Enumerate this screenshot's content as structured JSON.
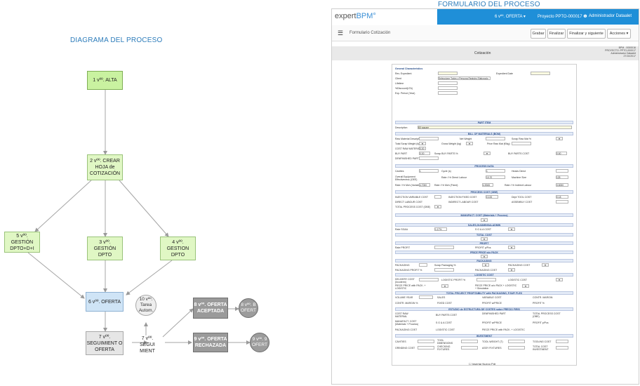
{
  "diagram": {
    "title": "DIAGRAMA DEL PROCESO",
    "nodes": {
      "n1": "1 vºº. ALTA",
      "n2": "2 vºº. CREAR HOJA de COTIZACIÓN",
      "n3": "3 vºº. GESTIÓN DPTO",
      "n4": "4 vºº. GESTION DPTO",
      "n5": "5 vºº. GESTIÓN DPTO+D+I",
      "n6": "6 vºº. OFERTA",
      "n7": "7 vºº. SEGUIMIENT O OFERTA",
      "n8": "8 vºº. OFERTA ACEPTADA",
      "n9": "9 vºº. OFERTA RECHAZADA",
      "n10": "10 vºº. Tarea Autom.",
      "seg": "7 vºº. SEGUI MIENT",
      "n8b": "8 vºº. B OFERT",
      "n9b": "9 vºº. 9 OFERT"
    }
  },
  "form": {
    "title": "FORMULARIO DEL PROCESO",
    "logo_a": "expert",
    "logo_b": "BPM",
    "logo_c": "°",
    "nav": {
      "oferta": "6 vºº. OFERTA ▾",
      "proyecto": "Proyecto PPTO-000017 ❶",
      "admin": "Administrador Dataalet"
    },
    "subtitle": "Formulario Cotización",
    "buttons": {
      "grabar": "Grabar",
      "finalizar": "Finalizar",
      "finalizar_siguiente": "Finalizar y siguiente",
      "acciones": "Acciones ▾"
    },
    "band_title": "Cotización",
    "meta": [
      "BPM - 0000016",
      "PROYECTO: PPTO-000017",
      "Administrador Dataalet",
      "27/10/2017"
    ],
    "general": "General Characteristics",
    "gen_labels": [
      "Rev. Expedient",
      "Client",
      "Lifetime",
      "%Discount(LTA)",
      "Exp. Period (Year)"
    ],
    "gen_client": "Seleccione Todos y Persona Registro Elaborado",
    "exp_date": "Expedient Date",
    "sections": {
      "part": "PART ITEM",
      "bom": "BILL OF MATERIALS (BOM)",
      "process": "PROCESS DATA",
      "proc_cost": "PROCESS COST (OBE)",
      "manufact": "MANUFACT. COST (Materials + Process)",
      "sga": "SALES,G/ADMINSALADMIN",
      "total": "TOTAL COST",
      "profit": "PROFIT",
      "price": "PRICE PRICE w/o PACK",
      "packaging": "PACKAGING",
      "logistic": "LOGISTIC COST",
      "tppp": "TOTAL PROJECT PROFITABILITY with PACKAGING, F.SUP. FLEX",
      "estudio": "ESTUDIO de ESTRUCTURA DE COSTES sobre PRECIO FIRIS",
      "invest": "INVESTMENT"
    },
    "description_label": "Description",
    "description_value": "B3 square",
    "bom_labels": [
      "Raw Material Description",
      "Total Scrap Weight (kg)",
      "COST RAW MATERIAL",
      "BUY PART",
      "DENFINISHED PART"
    ],
    "bom_mid": [
      "Net Weight",
      "Gross Weight (kg)",
      "Scrap BUY PARTS %"
    ],
    "bom_right": [
      "Scrap Raw Mat %",
      "Price Raw Mat (€/kg)",
      "BUY PARTS COST"
    ],
    "bom_values": [
      "0.00",
      "0.00",
      "0.00",
      "0.60"
    ],
    "proc_labels": [
      "Cavities",
      "Overall Equipment Effectiveness (OEE)",
      "Rate / Hr Mch (Variable)"
    ],
    "proc_mid": [
      "Cycle (s)",
      "Rate / Hr Direct Labour",
      "Rate / Hr Mch (Fixed)"
    ],
    "proc_right": [
      "Heads Direct",
      "Machine Size",
      "Rate / Hr Indirect Labour"
    ],
    "proc_values": [
      "1",
      "1",
      "10.70",
      "125",
      "4.7000",
      "4.5945",
      "3.8000"
    ],
    "cost_labels": [
      "INJECTION VARIABLE COST",
      "DIRECT LABOUR COST",
      "TOTAL PROCESS COST (OBE)"
    ],
    "cost_mid": [
      "INJECTION FIXED COST",
      "INDIRECT LABOUR COST"
    ],
    "cost_right": [
      "Dept TOOL COST",
      "ASSEMBLY COST"
    ],
    "cost_values": [
      "0.100",
      "0.18"
    ],
    "sga_labels": [
      "Rate SG&A",
      "S G & A COST"
    ],
    "sga_value": "1.17%",
    "profit_labels": [
      "Rate PROFIT",
      "PROFIT p/Pcs"
    ],
    "pack_labels": [
      "PACKAGING",
      "PACKAGING PROFIT %",
      "Scrap Packaging %",
      "PACKAGING COST",
      "PACKAGING COST"
    ],
    "log_labels": [
      "DELIVERY COST (Incoterm)",
      "PIECE PRICE with PACK. + LOGISTIC",
      "LOGISTIC PROFIT %",
      "LOGISTIC COST",
      "PIECE PRICE w/o PACK + LOGISTIC + Simulation"
    ],
    "tp_labels": [
      "VOLUME YEAR",
      "CONTR. MARGIN %",
      "SALES",
      "FIXED COST",
      "VARIABLE COST",
      "PROFIT w/PRICE",
      "CONTR. MARGIN",
      "PROFIT %"
    ],
    "est_labels": [
      "COST RAW MATERIAL",
      "MANUFACT. COST (Materials + Process)",
      "PACKAGING COST",
      "BUY PARTS COST",
      "S G & A COST",
      "LOGISTIC COST",
      "DENFINISHED PART",
      "PROFIT w/PRICE",
      "PIECE PRICE with PACK. + LOGISTIC",
      "TOTAL PROCESS COST (OBE)",
      "PROFIT p/Pcs"
    ],
    "inv_labels": [
      "CAVITIES",
      "GRINDING COST",
      "TOOL DIMENSIONS",
      "CHECKING FIXTURES",
      "TOOL WEIGHT (T)",
      "ASSY FIXTURES",
      "TOOLING COST",
      "TOTAL COST INVESTMENT"
    ],
    "footer": "Insertar Nuevo Pdt"
  }
}
